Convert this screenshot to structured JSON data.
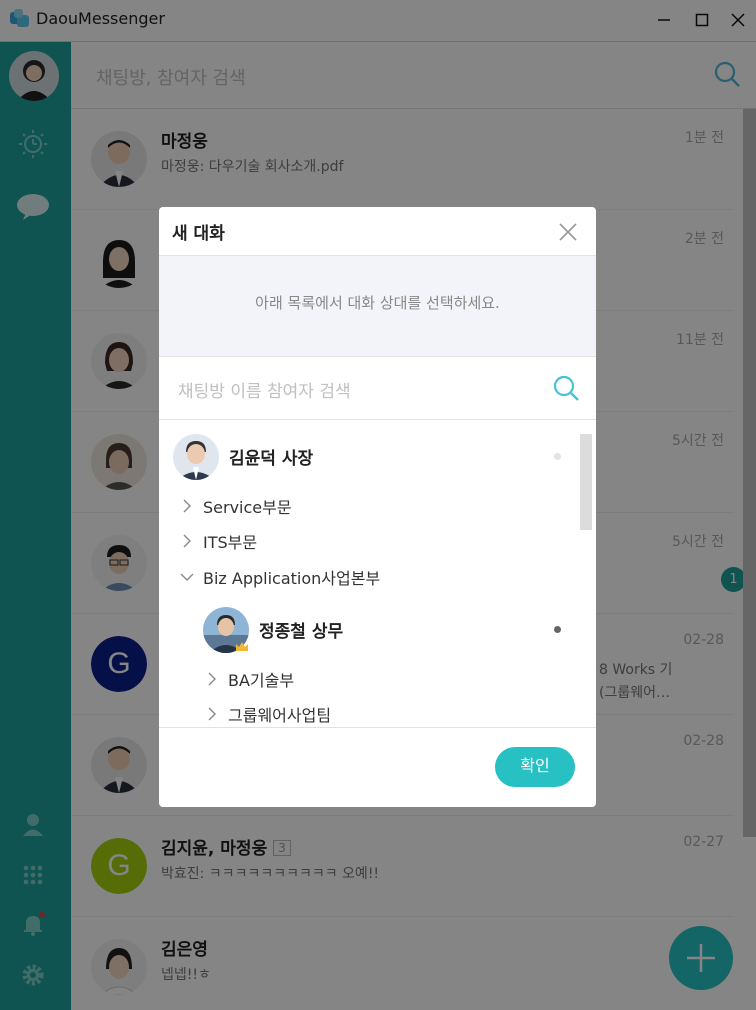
{
  "app": {
    "title": "DaouMessenger"
  },
  "search": {
    "placeholder": "채팅방, 참여자 검색"
  },
  "chats": [
    {
      "name": "마정웅",
      "message": "마정웅: 다우기술 회사소개.pdf",
      "time": "1분 전"
    },
    {
      "name": "",
      "message": "",
      "time": "2분 전"
    },
    {
      "name": "",
      "message": "",
      "time": "11분 전"
    },
    {
      "name": "",
      "message": "",
      "time": "5시간 전"
    },
    {
      "name": "",
      "message": "",
      "time": "5시간 전",
      "unread": "1"
    },
    {
      "name": "",
      "message": "8 Works 기",
      "message2": "(그룹웨어…",
      "time": "02-28",
      "avatar_letter": "G",
      "avatar_color": "#0b1f8c"
    },
    {
      "name": "",
      "message": "",
      "time": "02-28"
    },
    {
      "name": "김지윤, 마정웅",
      "count": "3",
      "message": "박효진: ㅋㅋㅋㅋㅋㅋㅋㅋㅋㅋ 오예!!",
      "time": "02-27",
      "avatar_letter": "G",
      "avatar_color": "#a5cf0e"
    },
    {
      "name": "김은영",
      "message": "넵넵!!ㅎ",
      "time": ""
    }
  ],
  "modal": {
    "title": "새 대화",
    "info": "아래 목록에서 대화 상대를 선택하세요.",
    "search_placeholder": "채팅방 이름 참여자 검색",
    "tree": {
      "top_person": {
        "name": "김윤덕 사장",
        "status_color": "#e3e3e3"
      },
      "nodes": [
        {
          "label": "Service부문",
          "state": "collapsed"
        },
        {
          "label": "ITS부문",
          "state": "collapsed"
        },
        {
          "label": "Biz Application사업본부",
          "state": "expanded"
        }
      ],
      "sub_person": {
        "name": "정종철 상무",
        "status_color": "#666666"
      },
      "sub_nodes": [
        {
          "label": "BA기술부",
          "state": "collapsed"
        },
        {
          "label": "그룹웨어사업팀",
          "state": "collapsed"
        }
      ]
    },
    "confirm_label": "확인"
  },
  "colors": {
    "sidebar": "#1ea19b",
    "accent": "#27c1c4"
  },
  "icons": [
    "app-logo-icon",
    "minimize-icon",
    "maximize-icon",
    "close-icon",
    "sun-clock-icon",
    "chat-bubble-icon",
    "person-icon",
    "apps-grid-icon",
    "bell-icon",
    "gear-icon",
    "search-icon",
    "chevron-right-icon",
    "chevron-down-icon",
    "crown-icon",
    "plus-icon"
  ]
}
